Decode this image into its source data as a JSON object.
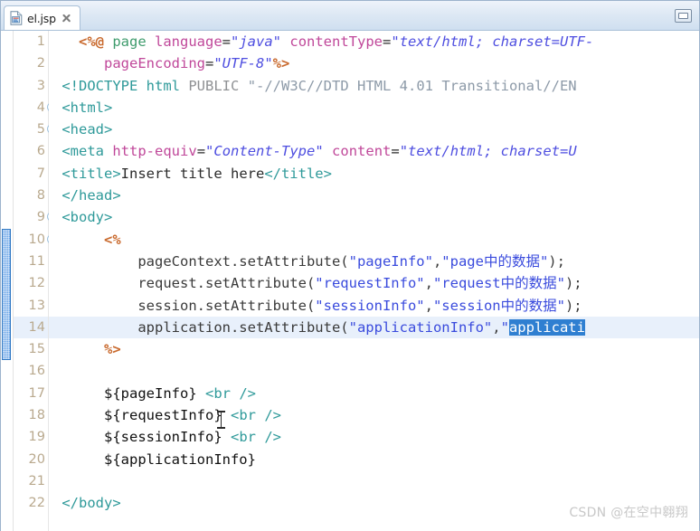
{
  "window": {
    "minimize_label": "Minimize",
    "minimize_icon": "minimize-icon"
  },
  "tab": {
    "label": "el.jsp",
    "file_icon": "jsp-file-icon",
    "close_icon": "close-icon"
  },
  "editor": {
    "change_bar_from_line": 10,
    "change_bar_to_line": 15,
    "highlighted_line": 14,
    "fold_lines": [
      4,
      5,
      9,
      10
    ],
    "selection_text": "applicati",
    "line_numbers": [
      1,
      2,
      3,
      4,
      5,
      6,
      7,
      8,
      9,
      10,
      11,
      12,
      13,
      14,
      15,
      16,
      17,
      18,
      19,
      20,
      21,
      22
    ],
    "lines": [
      {
        "number": 1,
        "tokens": [
          {
            "text": "   ",
            "type": "plain"
          },
          {
            "text": "<%@",
            "type": "jspdelim"
          },
          {
            "text": " ",
            "type": "plain"
          },
          {
            "text": "page",
            "type": "greenkw"
          },
          {
            "text": " ",
            "type": "plain"
          },
          {
            "text": "language",
            "type": "attr"
          },
          {
            "text": "=",
            "type": "plain"
          },
          {
            "text": "\"java\"",
            "type": "attrval"
          },
          {
            "text": " ",
            "type": "plain"
          },
          {
            "text": "contentType",
            "type": "attr"
          },
          {
            "text": "=",
            "type": "plain"
          },
          {
            "text": "\"text/html; charset=UTF-",
            "type": "attrval"
          }
        ]
      },
      {
        "number": 2,
        "tokens": [
          {
            "text": "      ",
            "type": "plain"
          },
          {
            "text": "pageEncoding",
            "type": "attr"
          },
          {
            "text": "=",
            "type": "plain"
          },
          {
            "text": "\"UTF-8\"",
            "type": "attrval"
          },
          {
            "text": "%>",
            "type": "jspdelim"
          }
        ]
      },
      {
        "number": 3,
        "tokens": [
          {
            "text": " ",
            "type": "plain"
          },
          {
            "text": "<!DOCTYPE html",
            "type": "doctype"
          },
          {
            "text": " ",
            "type": "plain"
          },
          {
            "text": "PUBLIC",
            "type": "gray"
          },
          {
            "text": " ",
            "type": "plain"
          },
          {
            "text": "\"-//W3C//DTD HTML 4.01 Transitional//EN",
            "type": "graystr"
          }
        ]
      },
      {
        "number": 4,
        "tokens": [
          {
            "text": " ",
            "type": "plain"
          },
          {
            "text": "<html>",
            "type": "tag"
          }
        ]
      },
      {
        "number": 5,
        "tokens": [
          {
            "text": " ",
            "type": "plain"
          },
          {
            "text": "<head>",
            "type": "tag"
          }
        ]
      },
      {
        "number": 6,
        "tokens": [
          {
            "text": " ",
            "type": "plain"
          },
          {
            "text": "<meta",
            "type": "tag"
          },
          {
            "text": " ",
            "type": "plain"
          },
          {
            "text": "http-equiv",
            "type": "attr"
          },
          {
            "text": "=",
            "type": "plain"
          },
          {
            "text": "\"Content-Type\"",
            "type": "attrval"
          },
          {
            "text": " ",
            "type": "plain"
          },
          {
            "text": "content",
            "type": "attr"
          },
          {
            "text": "=",
            "type": "plain"
          },
          {
            "text": "\"text/html; charset=U",
            "type": "attrval"
          }
        ]
      },
      {
        "number": 7,
        "tokens": [
          {
            "text": " ",
            "type": "plain"
          },
          {
            "text": "<title>",
            "type": "tag"
          },
          {
            "text": "Insert title here",
            "type": "plain"
          },
          {
            "text": "</title>",
            "type": "tag"
          }
        ]
      },
      {
        "number": 8,
        "tokens": [
          {
            "text": " ",
            "type": "plain"
          },
          {
            "text": "</head>",
            "type": "tag"
          }
        ]
      },
      {
        "number": 9,
        "tokens": [
          {
            "text": " ",
            "type": "plain"
          },
          {
            "text": "<body>",
            "type": "tag"
          }
        ]
      },
      {
        "number": 10,
        "tokens": [
          {
            "text": "      ",
            "type": "plain"
          },
          {
            "text": "<%",
            "type": "jspdelim"
          }
        ]
      },
      {
        "number": 11,
        "tokens": [
          {
            "text": "          ",
            "type": "plain"
          },
          {
            "text": "pageContext.setAttribute(",
            "type": "java"
          },
          {
            "text": "\"pageInfo\"",
            "type": "string"
          },
          {
            "text": ",",
            "type": "java"
          },
          {
            "text": "\"page中的数据\"",
            "type": "string"
          },
          {
            "text": ");",
            "type": "java"
          }
        ]
      },
      {
        "number": 12,
        "tokens": [
          {
            "text": "          ",
            "type": "plain"
          },
          {
            "text": "request.setAttribute(",
            "type": "java"
          },
          {
            "text": "\"requestInfo\"",
            "type": "string"
          },
          {
            "text": ",",
            "type": "java"
          },
          {
            "text": "\"request中的数据\"",
            "type": "string"
          },
          {
            "text": ");",
            "type": "java"
          }
        ]
      },
      {
        "number": 13,
        "tokens": [
          {
            "text": "          ",
            "type": "plain"
          },
          {
            "text": "session.setAttribute(",
            "type": "java"
          },
          {
            "text": "\"sessionInfo\"",
            "type": "string"
          },
          {
            "text": ",",
            "type": "java"
          },
          {
            "text": "\"session中的数据\"",
            "type": "string"
          },
          {
            "text": ");",
            "type": "java"
          }
        ]
      },
      {
        "number": 14,
        "tokens": [
          {
            "text": "          ",
            "type": "plain"
          },
          {
            "text": "application.setAttribute(",
            "type": "java"
          },
          {
            "text": "\"applicationInfo\"",
            "type": "string"
          },
          {
            "text": ",",
            "type": "java"
          },
          {
            "text": "\"",
            "type": "string"
          },
          {
            "text": "applicati",
            "type": "selection"
          }
        ]
      },
      {
        "number": 15,
        "tokens": [
          {
            "text": "      ",
            "type": "plain"
          },
          {
            "text": "%>",
            "type": "jspdelim"
          }
        ]
      },
      {
        "number": 16,
        "tokens": []
      },
      {
        "number": 17,
        "tokens": [
          {
            "text": "      ",
            "type": "plain"
          },
          {
            "text": "${pageInfo}",
            "type": "el"
          },
          {
            "text": " ",
            "type": "plain"
          },
          {
            "text": "<br />",
            "type": "tag"
          }
        ]
      },
      {
        "number": 18,
        "tokens": [
          {
            "text": "      ",
            "type": "plain"
          },
          {
            "text": "${requestInfo}",
            "type": "el"
          },
          {
            "text": " ",
            "type": "plain"
          },
          {
            "text": "<br />",
            "type": "tag"
          }
        ]
      },
      {
        "number": 19,
        "tokens": [
          {
            "text": "      ",
            "type": "plain"
          },
          {
            "text": "${sessionInfo}",
            "type": "el"
          },
          {
            "text": " ",
            "type": "plain"
          },
          {
            "text": "<br />",
            "type": "tag"
          }
        ]
      },
      {
        "number": 20,
        "tokens": [
          {
            "text": "      ",
            "type": "plain"
          },
          {
            "text": "${applicationInfo}",
            "type": "el"
          }
        ]
      },
      {
        "number": 21,
        "tokens": []
      },
      {
        "number": 22,
        "tokens": [
          {
            "text": " ",
            "type": "plain"
          },
          {
            "text": "</body>",
            "type": "tag"
          }
        ]
      }
    ]
  },
  "watermark": {
    "text": "CSDN @在空中翱翔"
  },
  "colors": {
    "selection_bg": "#2f7fd1",
    "highlight_line_bg": "#e8f0fb",
    "change_bar": "#6ca6e8",
    "jsp_delim": "#c96a2e",
    "tag": "#2f9a9a",
    "attr": "#c0489a",
    "attr_value": "#4e4ee0",
    "string": "#3a4bdd",
    "line_number": "#b9a98e"
  }
}
